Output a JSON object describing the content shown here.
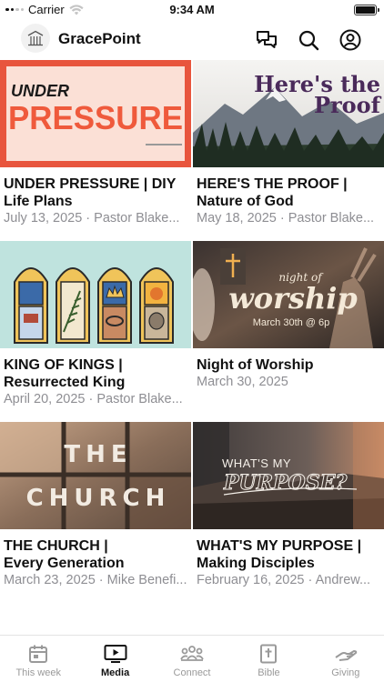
{
  "status_bar": {
    "carrier": "Carrier",
    "time": "9:34 AM"
  },
  "header": {
    "app_title": "GracePoint",
    "icons": [
      "chat-icon",
      "search-icon",
      "account-icon"
    ]
  },
  "media": {
    "items": [
      {
        "thumb_text": "UNDER",
        "thumb_text2": "PRESSURE",
        "title_line1": "UNDER PRESSURE | DIY",
        "title_line2": "Life Plans",
        "meta": "July 13, 2025 · Pastor Blake..."
      },
      {
        "thumb_text": "Here's the",
        "thumb_text2": "Proof",
        "title_line1": "HERE'S THE PROOF |",
        "title_line2": "Nature of God",
        "meta": "May 18, 2025 · Pastor Blake..."
      },
      {
        "title_line1": "KING OF KINGS |",
        "title_line2": "Resurrected King",
        "meta": "April 20, 2025 · Pastor Blake..."
      },
      {
        "thumb_text": "night of",
        "thumb_text2": "worship",
        "thumb_text3": "March 30th @ 6p",
        "title_line1": "Night of Worship",
        "title_line2": "",
        "meta": "March 30, 2025"
      },
      {
        "thumb_text": "THE",
        "thumb_text2": "CHURCH",
        "title_line1": "THE CHURCH |",
        "title_line2": "Every Generation",
        "meta": "March 23, 2025 · Mike Benefi..."
      },
      {
        "thumb_text": "WHAT'S MY",
        "thumb_text2": "PURPOSE?",
        "title_line1": "WHAT'S MY PURPOSE |",
        "title_line2": "Making Disciples",
        "meta": "February 16, 2025 · Andrew..."
      }
    ]
  },
  "tab_bar": {
    "tabs": [
      {
        "label": "This week",
        "icon": "calendar-icon",
        "active": false
      },
      {
        "label": "Media",
        "icon": "tv-play-icon",
        "active": true
      },
      {
        "label": "Connect",
        "icon": "people-icon",
        "active": false
      },
      {
        "label": "Bible",
        "icon": "bible-icon",
        "active": false
      },
      {
        "label": "Giving",
        "icon": "giving-hand-icon",
        "active": false
      }
    ]
  },
  "colors": {
    "accent_active": "#111111",
    "inactive": "#9a9a9a",
    "meta_text": "#8e8e93",
    "pressure_orange": "#ef5a3c"
  }
}
